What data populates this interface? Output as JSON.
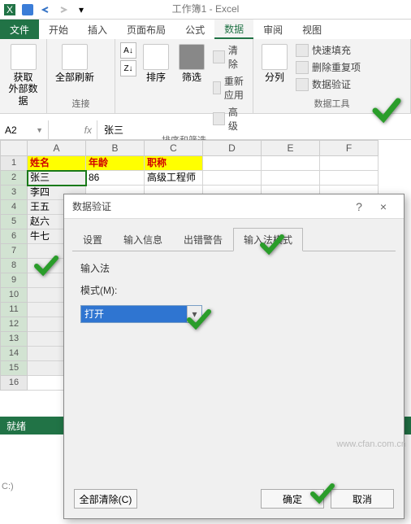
{
  "app": {
    "title": "工作簿1 - Excel"
  },
  "qat_icons": [
    "excel-icon",
    "save-icon",
    "undo-icon",
    "redo-icon",
    "customize-icon"
  ],
  "tabs": {
    "file": "文件",
    "home": "开始",
    "insert": "插入",
    "layout": "页面布局",
    "formulas": "公式",
    "data": "数据",
    "review": "审阅",
    "view": "视图"
  },
  "ribbon": {
    "get_data": "获取\n外部数据",
    "refresh": "全部刷新",
    "connections": "连接",
    "sort": "排序",
    "filter": "筛选",
    "clear": "清除",
    "reapply": "重新应用",
    "advanced": "高级",
    "sort_filter_group": "排序和筛选",
    "text_to_cols": "分列",
    "flash_fill": "快速填充",
    "remove_dup": "删除重复项",
    "data_val": "数据验证",
    "data_tools_group": "数据工具"
  },
  "namebox": "A2",
  "formula_value": "张三",
  "columns": [
    "A",
    "B",
    "C",
    "D",
    "E",
    "F"
  ],
  "headers": {
    "c1": "姓名",
    "c2": "年龄",
    "c3": "职称"
  },
  "rows": [
    {
      "n": "1"
    },
    {
      "n": "2",
      "a": "张三",
      "b": "",
      "c": "86 高级工程师"
    },
    {
      "n": "3",
      "a": "李四"
    },
    {
      "n": "4",
      "a": "王五"
    },
    {
      "n": "5",
      "a": "赵六"
    },
    {
      "n": "6",
      "a": "牛七"
    },
    {
      "n": "7"
    },
    {
      "n": "8"
    },
    {
      "n": "9"
    },
    {
      "n": "10"
    },
    {
      "n": "11"
    },
    {
      "n": "12"
    },
    {
      "n": "13"
    },
    {
      "n": "14"
    },
    {
      "n": "15"
    },
    {
      "n": "16"
    }
  ],
  "dialog": {
    "title": "数据验证",
    "help": "?",
    "close": "×",
    "tabs": {
      "settings": "设置",
      "input_msg": "输入信息",
      "error": "出错警告",
      "ime": "输入法模式"
    },
    "section": "输入法",
    "mode_label": "模式(M):",
    "mode_value": "打开",
    "clear_all": "全部清除(C)",
    "ok": "确定",
    "cancel": "取消"
  },
  "status": "就绪",
  "watermark": "www.cfan.com.cn",
  "drive": "C:)"
}
